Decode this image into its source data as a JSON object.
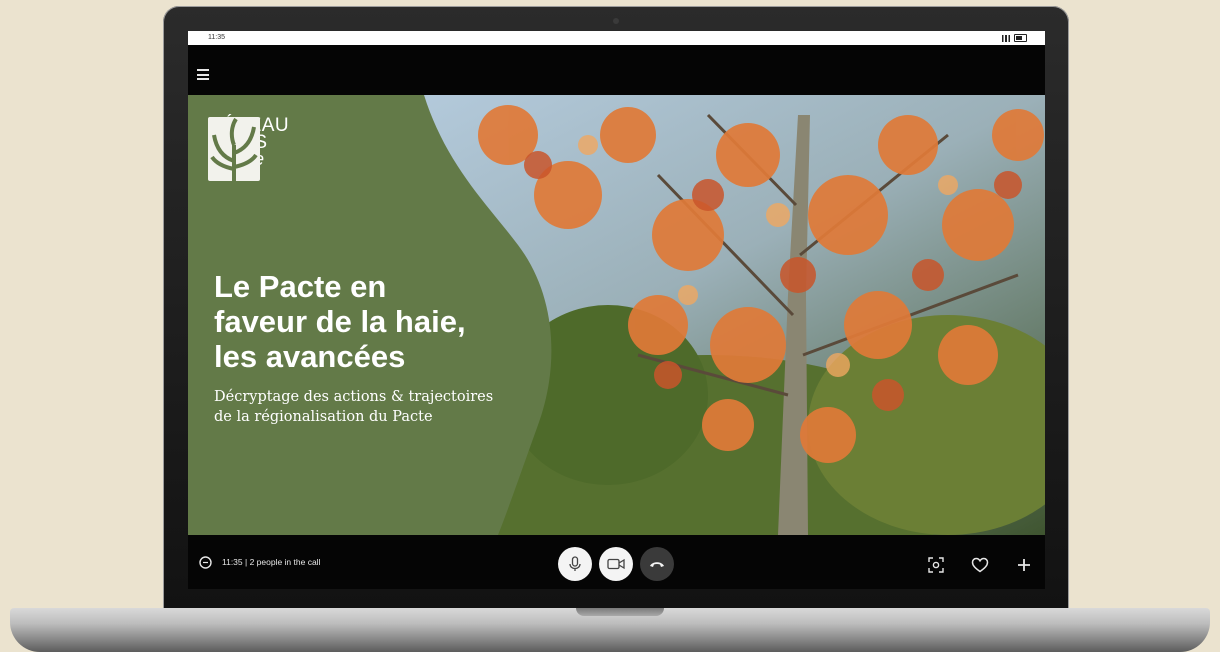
{
  "status_bar": {
    "time": "11:35"
  },
  "slide": {
    "logo": {
      "line1": "RÉSEAU",
      "line2": "HAIES",
      "line3": "France"
    },
    "title_line1": "Le Pacte en",
    "title_line2": "faveur de la haie,",
    "title_line3": "les avancées",
    "subtitle_line1": "Décryptage des actions & trajectoires",
    "subtitle_line2": "de la régionalisation du Pacte"
  },
  "call_bar": {
    "info": "11:35 | 2 people in the call",
    "buttons": [
      "microphone-icon",
      "camera-icon",
      "hang-up-icon"
    ],
    "right_icons": [
      "screenshot-icon",
      "heart-icon",
      "plus-icon"
    ]
  },
  "colors": {
    "background": "#ebe3cf",
    "slide_green": "#637a48",
    "foliage_orange": "#e07a38",
    "hang_up": "#3a3a3a"
  }
}
